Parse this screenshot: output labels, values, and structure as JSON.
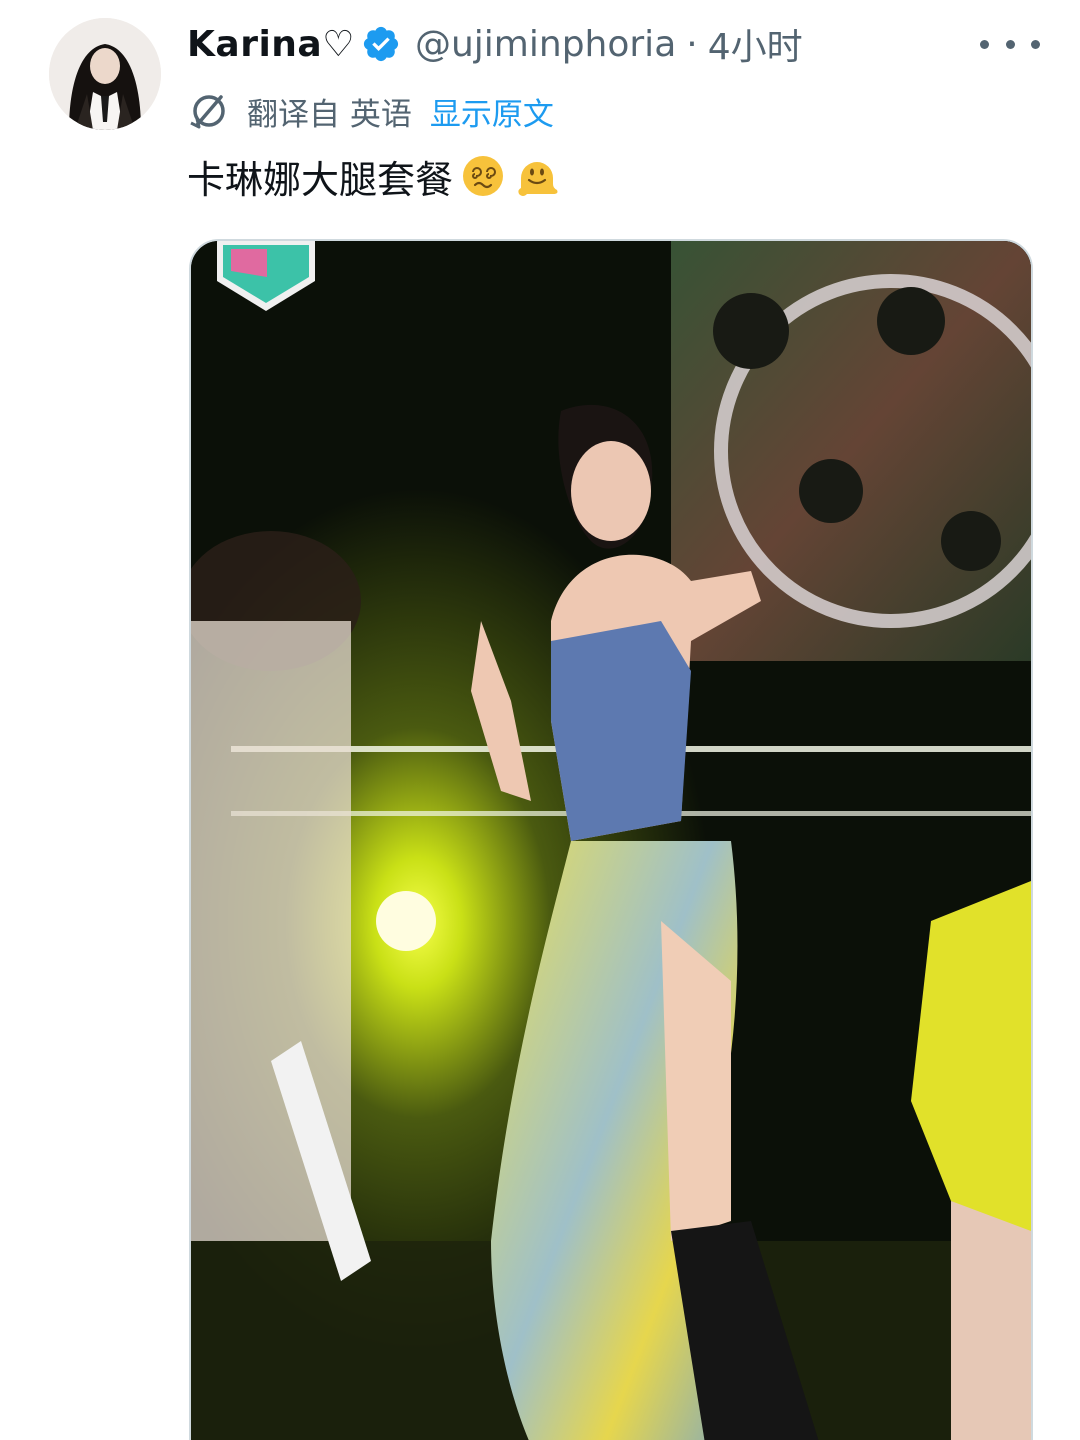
{
  "tweet": {
    "display_name": "Karina♡",
    "handle": "@ujiminphoria",
    "separator": "·",
    "time": "4小时",
    "translate": {
      "translated_from": "翻译自 英语",
      "show_original": "显示原文"
    },
    "text": "卡琳娜大腿套餐",
    "emojis": [
      "dizzy-face-emoji",
      "melting-face-emoji"
    ],
    "media": {
      "type": "photo",
      "description_icon": "stage-photo"
    }
  },
  "colors": {
    "accent": "#1d9bf0",
    "secondary_text": "#536471",
    "primary_text": "#0f1419",
    "border": "#cfd9de"
  }
}
